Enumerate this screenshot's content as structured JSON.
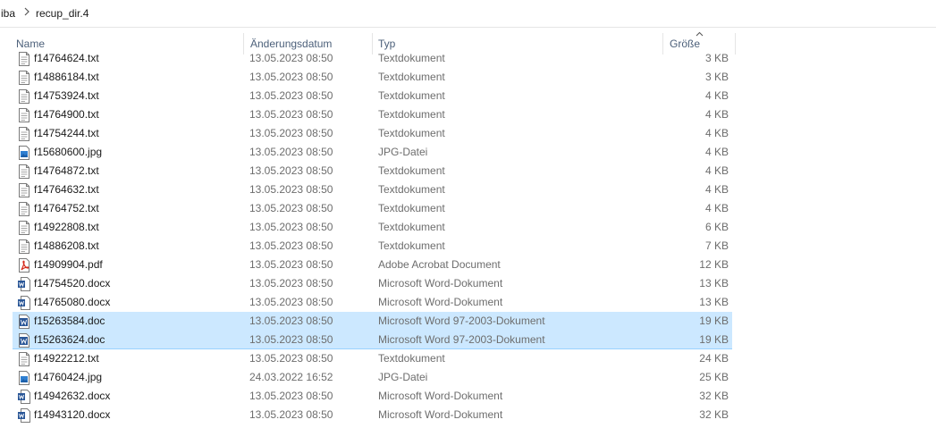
{
  "breadcrumb": {
    "parent": "iba",
    "current": "recup_dir.4"
  },
  "columns": {
    "name": "Name",
    "date": "Änderungsdatum",
    "type": "Typ",
    "size": "Größe"
  },
  "colors": {
    "selection": "#cce8ff",
    "selection_border": "#99d1ff",
    "header_text": "#4c607a",
    "secondary_text": "#6d6d6d"
  },
  "files": [
    {
      "name": "f14764624.txt",
      "date": "13.05.2023 08:50",
      "type": "Textdokument",
      "size": "3 KB",
      "icon": "txt",
      "selected": false
    },
    {
      "name": "f14886184.txt",
      "date": "13.05.2023 08:50",
      "type": "Textdokument",
      "size": "3 KB",
      "icon": "txt",
      "selected": false
    },
    {
      "name": "f14753924.txt",
      "date": "13.05.2023 08:50",
      "type": "Textdokument",
      "size": "4 KB",
      "icon": "txt",
      "selected": false
    },
    {
      "name": "f14764900.txt",
      "date": "13.05.2023 08:50",
      "type": "Textdokument",
      "size": "4 KB",
      "icon": "txt",
      "selected": false
    },
    {
      "name": "f14754244.txt",
      "date": "13.05.2023 08:50",
      "type": "Textdokument",
      "size": "4 KB",
      "icon": "txt",
      "selected": false
    },
    {
      "name": "f15680600.jpg",
      "date": "13.05.2023 08:50",
      "type": "JPG-Datei",
      "size": "4 KB",
      "icon": "jpg",
      "selected": false
    },
    {
      "name": "f14764872.txt",
      "date": "13.05.2023 08:50",
      "type": "Textdokument",
      "size": "4 KB",
      "icon": "txt",
      "selected": false
    },
    {
      "name": "f14764632.txt",
      "date": "13.05.2023 08:50",
      "type": "Textdokument",
      "size": "4 KB",
      "icon": "txt",
      "selected": false
    },
    {
      "name": "f14764752.txt",
      "date": "13.05.2023 08:50",
      "type": "Textdokument",
      "size": "4 KB",
      "icon": "txt",
      "selected": false
    },
    {
      "name": "f14922808.txt",
      "date": "13.05.2023 08:50",
      "type": "Textdokument",
      "size": "6 KB",
      "icon": "txt",
      "selected": false
    },
    {
      "name": "f14886208.txt",
      "date": "13.05.2023 08:50",
      "type": "Textdokument",
      "size": "7 KB",
      "icon": "txt",
      "selected": false
    },
    {
      "name": "f14909904.pdf",
      "date": "13.05.2023 08:50",
      "type": "Adobe Acrobat Document",
      "size": "12 KB",
      "icon": "pdf",
      "selected": false
    },
    {
      "name": "f14754520.docx",
      "date": "13.05.2023 08:50",
      "type": "Microsoft Word-Dokument",
      "size": "13 KB",
      "icon": "word",
      "selected": false
    },
    {
      "name": "f14765080.docx",
      "date": "13.05.2023 08:50",
      "type": "Microsoft Word-Dokument",
      "size": "13 KB",
      "icon": "word",
      "selected": false
    },
    {
      "name": "f15263584.doc",
      "date": "13.05.2023 08:50",
      "type": "Microsoft Word 97-2003-Dokument",
      "size": "19 KB",
      "icon": "word97",
      "selected": true
    },
    {
      "name": "f15263624.doc",
      "date": "13.05.2023 08:50",
      "type": "Microsoft Word 97-2003-Dokument",
      "size": "19 KB",
      "icon": "word97",
      "selected": true
    },
    {
      "name": "f14922212.txt",
      "date": "13.05.2023 08:50",
      "type": "Textdokument",
      "size": "24 KB",
      "icon": "txt",
      "selected": false
    },
    {
      "name": "f14760424.jpg",
      "date": "24.03.2022 16:52",
      "type": "JPG-Datei",
      "size": "25 KB",
      "icon": "jpg",
      "selected": false
    },
    {
      "name": "f14942632.docx",
      "date": "13.05.2023 08:50",
      "type": "Microsoft Word-Dokument",
      "size": "32 KB",
      "icon": "word",
      "selected": false
    },
    {
      "name": "f14943120.docx",
      "date": "13.05.2023 08:50",
      "type": "Microsoft Word-Dokument",
      "size": "32 KB",
      "icon": "word",
      "selected": false
    }
  ]
}
